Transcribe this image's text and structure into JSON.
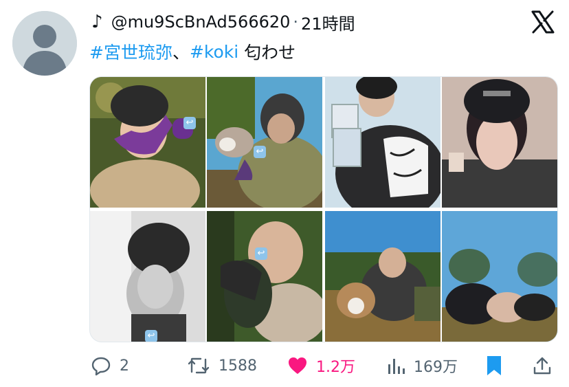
{
  "tweet": {
    "note_glyph": "♪",
    "handle": "@mu9ScBnAd566620",
    "separator": "·",
    "time": "21時間",
    "text": {
      "hashtag1": "#宮世琉弥",
      "comma": "、",
      "hashtag2": "#koki",
      "rest": " 匂わせ"
    }
  },
  "media": {
    "alt_badge_glyph": "↩",
    "photos_left": [
      "photo-beanie-purple-scarf",
      "photo-dog-green-jacket",
      "photo-bw-beanie",
      "photo-hug-dog"
    ],
    "photos_right": [
      "photo-leather-jacket-cards",
      "photo-black-beanie-closeup",
      "photo-dog-field",
      "photo-lying-grass"
    ]
  },
  "actions": {
    "reply_count": "2",
    "retweet_count": "1588",
    "like_count": "1.2万",
    "views_count": "169万"
  },
  "colors": {
    "accent": "#1d9bf0",
    "like": "#f91880",
    "muted": "#536471",
    "text": "#0f1419"
  },
  "icons": [
    "avatar-placeholder-icon",
    "x-logo-icon",
    "reply-icon",
    "retweet-icon",
    "heart-icon",
    "views-icon",
    "bookmark-icon",
    "share-icon"
  ]
}
